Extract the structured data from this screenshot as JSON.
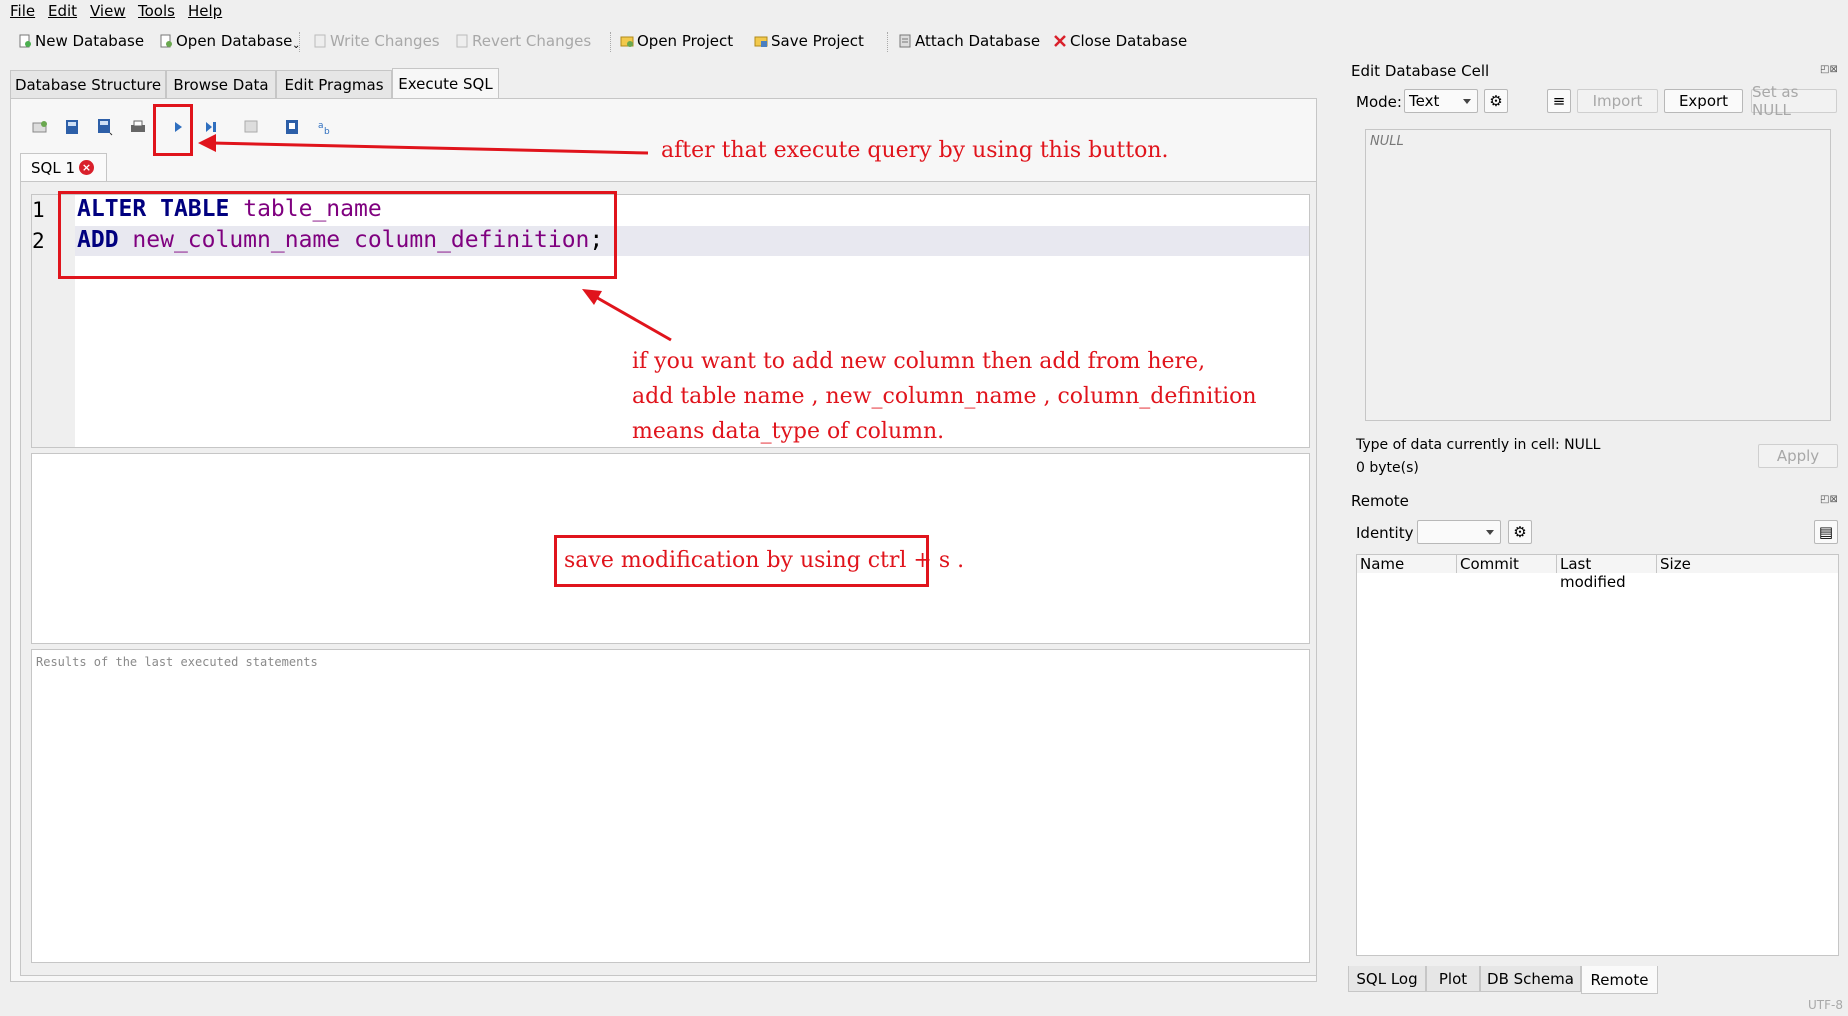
{
  "menu": [
    "File",
    "Edit",
    "View",
    "Tools",
    "Help"
  ],
  "toolbar": {
    "new_database": "New Database",
    "open_database": "Open Database",
    "write_changes": "Write Changes",
    "revert_changes": "Revert Changes",
    "open_project": "Open Project",
    "save_project": "Save Project",
    "attach_database": "Attach Database",
    "close_database": "Close Database"
  },
  "tabs": [
    "Database Structure",
    "Browse Data",
    "Edit Pragmas",
    "Execute SQL"
  ],
  "active_tab": "Execute SQL",
  "sql_tab": {
    "label": "SQL 1"
  },
  "editor": {
    "line_numbers": [
      "1",
      "2"
    ],
    "line1": {
      "kw1": "ALTER",
      "kw2": "TABLE",
      "ident": "table_name"
    },
    "line2": {
      "kw": "ADD",
      "ident1": "new_column_name",
      "ident2": "column_definition",
      "punct": ";"
    }
  },
  "results_placeholder": "Results of the last executed statements",
  "annotations": {
    "execute": "after that execute query by using this button.",
    "add_line1": "if you want to add new column then add from here,",
    "add_line2": "add table name , new_column_name , column_definition",
    "add_line3": "means data_type of column.",
    "save": "save modification by using ctrl + s ."
  },
  "edit_cell": {
    "title": "Edit Database Cell",
    "mode_label": "Mode:",
    "mode_value": "Text",
    "import": "Import",
    "export": "Export",
    "set_null": "Set as NULL",
    "null_placeholder": "NULL",
    "type_info": "Type of data currently in cell: NULL",
    "size_info": "0 byte(s)",
    "apply": "Apply"
  },
  "remote": {
    "title": "Remote",
    "identity_label": "Identity",
    "columns": [
      "Name",
      "Commit",
      "Last modified",
      "Size"
    ]
  },
  "bottom_tabs": [
    "SQL Log",
    "Plot",
    "DB Schema",
    "Remote"
  ],
  "status": {
    "encoding": "UTF-8"
  },
  "colors": {
    "annotation_red": "#e0141c",
    "keyword": "#00007f",
    "identifier": "#7f007f"
  }
}
